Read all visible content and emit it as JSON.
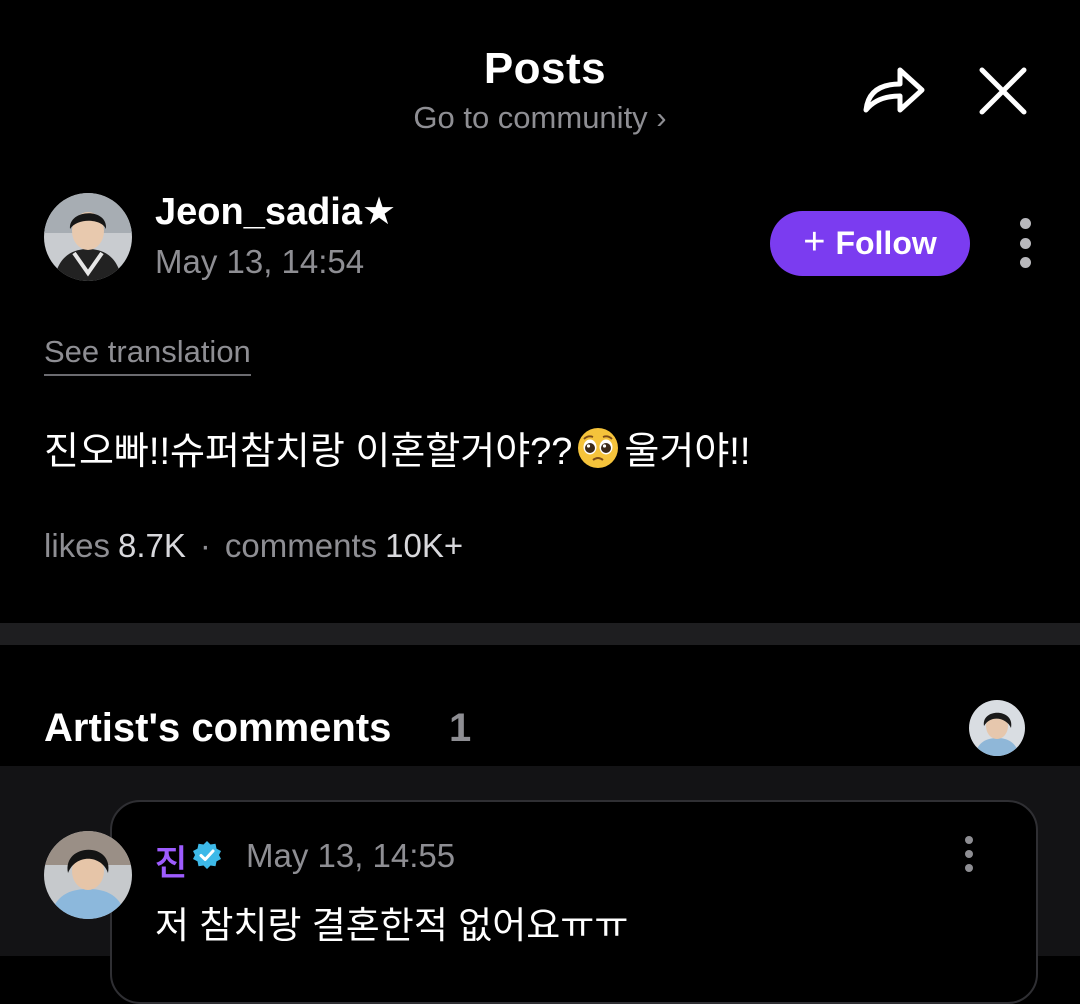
{
  "header": {
    "title": "Posts",
    "subtitle": "Go to community ›",
    "share_icon": "share-icon",
    "close_icon": "close-icon"
  },
  "post": {
    "author": "Jeon_sadia★",
    "date": "May 13, 14:54",
    "follow_label": "Follow",
    "follow_color": "#7b3cf0",
    "see_translation": "See translation",
    "body_before": "진오빠!!슈퍼참치랑 이혼할거야??",
    "body_emoji": "pleading-face-emoji",
    "body_after": "울거야!!",
    "likes_label": "likes",
    "likes_value": "8.7K",
    "separator": "·",
    "comments_label": "comments",
    "comments_value": "10K+"
  },
  "artist_comments": {
    "title": "Artist's comments",
    "count": "1",
    "comment": {
      "author": "진",
      "author_color": "#9e5cff",
      "verified_icon": "verified-badge-icon",
      "date": "May 13, 14:55",
      "text": "저 참치랑 결혼한적 없어요ㅠㅠ"
    }
  }
}
